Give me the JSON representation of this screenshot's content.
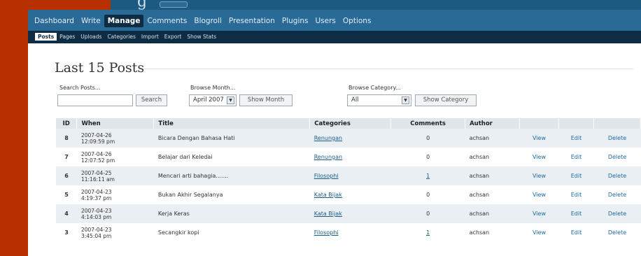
{
  "header": {
    "admin_menu": [
      "Dashboard",
      "Write",
      "Manage",
      "Comments",
      "Blogroll",
      "Presentation",
      "Plugins",
      "Users",
      "Options"
    ],
    "active_menu": "Manage"
  },
  "sub_menu": {
    "items": [
      "Posts",
      "Pages",
      "Uploads",
      "Categories",
      "Import",
      "Export",
      "Show Stats"
    ],
    "active": "Posts"
  },
  "page": {
    "title": "Last 15 Posts"
  },
  "filters": {
    "search_label": "Search Posts...",
    "search_value": "",
    "search_button": "Search",
    "month_label": "Browse Month...",
    "month_value": "April 2007",
    "month_button": "Show Month",
    "category_label": "Browse Category...",
    "category_value": "All",
    "category_button": "Show Category"
  },
  "table": {
    "headers": [
      "ID",
      "When",
      "Title",
      "Categories",
      "Comments",
      "Author",
      "",
      "",
      ""
    ],
    "rows": [
      {
        "id": "8",
        "date": "2007-04-26",
        "time": "12:09:59 pm",
        "title": "Bicara Dengan Bahasa Hati",
        "category": "Renungan",
        "comments": "0",
        "author": "achsan",
        "view": "View",
        "edit": "Edit",
        "delete": "Delete"
      },
      {
        "id": "7",
        "date": "2007-04-26",
        "time": "12:07:52 pm",
        "title": "Belajar dari Keledai",
        "category": "Renungan",
        "comments": "0",
        "author": "achsan",
        "view": "View",
        "edit": "Edit",
        "delete": "Delete"
      },
      {
        "id": "6",
        "date": "2007-04-25",
        "time": "11:16:11 am",
        "title": "Mencari arti bahagia.......",
        "category": "Filosophi",
        "comments": "1",
        "author": "achsan",
        "view": "View",
        "edit": "Edit",
        "delete": "Delete"
      },
      {
        "id": "5",
        "date": "2007-04-23",
        "time": "4:19:37 pm",
        "title": "Bukan Akhir Segalanya",
        "category": "Kata Bijak",
        "comments": "0",
        "author": "achsan",
        "view": "View",
        "edit": "Edit",
        "delete": "Delete"
      },
      {
        "id": "4",
        "date": "2007-04-23",
        "time": "4:14:03 pm",
        "title": "Kerja Keras",
        "category": "Kata Bijak",
        "comments": "0",
        "author": "achsan",
        "view": "View",
        "edit": "Edit",
        "delete": "Delete"
      },
      {
        "id": "3",
        "date": "2007-04-23",
        "time": "3:45:04 pm",
        "title": "Secangkir kopi",
        "category": "Filosophi",
        "comments": "1",
        "author": "achsan",
        "view": "View",
        "edit": "Edit",
        "delete": "Delete"
      }
    ]
  },
  "icons": {
    "select_arrow": "chevron-down-icon"
  },
  "colors": {
    "frame": "#b83000",
    "menu": "#2a6a96",
    "submenu": "#0e2d45",
    "link": "#1a5b8a"
  }
}
